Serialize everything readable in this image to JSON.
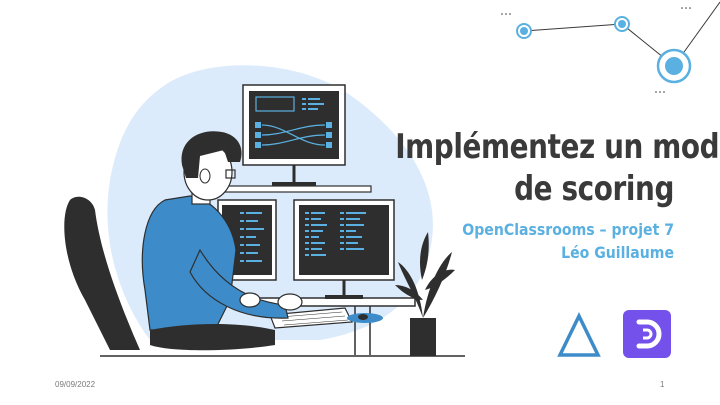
{
  "slide": {
    "title_line1": "Implémentez un modèle",
    "title_line2": "de scoring",
    "subtitle_line1": "OpenClassrooms – projet 7",
    "subtitle_line2": "Léo Guillaume",
    "date": "09/09/2022",
    "page_number": "1"
  },
  "colors": {
    "title": "#3a3a3a",
    "subtitle": "#5ab0e0",
    "blob": "#dcebfb",
    "shirt": "#3d8cc9",
    "dark": "#2e2e2e",
    "openclassrooms": "#7451eb",
    "network": "#5ab0e0"
  },
  "icons": [
    "developer-illustration",
    "network-nodes-decoration",
    "delta-logo-icon",
    "openclassrooms-logo-icon"
  ]
}
